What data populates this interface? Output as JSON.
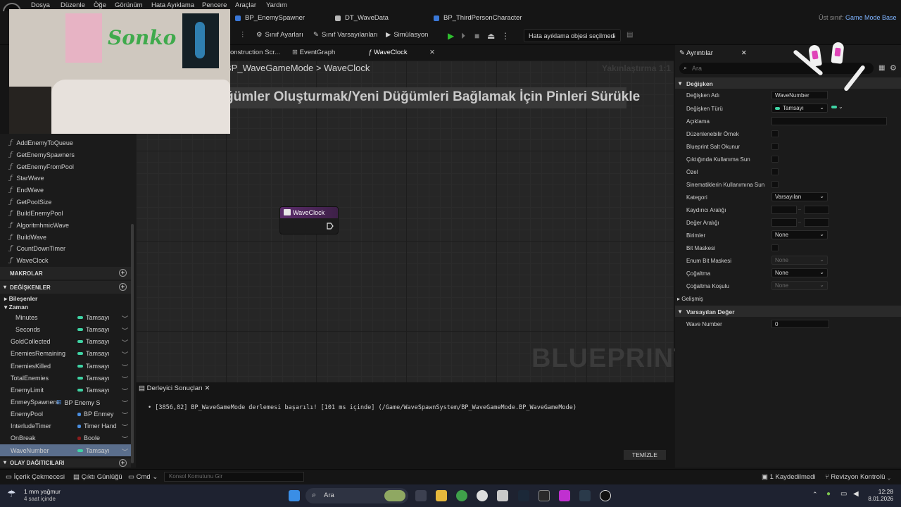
{
  "menu": [
    "Dosya",
    "Düzenle",
    "Öğe",
    "Görünüm",
    "Hata Ayıklama",
    "Pencere",
    "Araçlar",
    "Yardım"
  ],
  "tabs": {
    "items": [
      "BP_EnemySpawner",
      "DT_WaveData",
      "BP_ThirdPersonCharacter"
    ],
    "parent_label": "Üst sınıf:",
    "parent_value": "Game Mode Base"
  },
  "toolbar": {
    "class_settings": "Sınıf Ayarları",
    "class_defaults": "Sınıf Varsayılanları",
    "simulation": "Simülasyon",
    "debug_select": "Hata ayıklama objesi seçilmedi"
  },
  "graph_tabs": [
    "onstruction Scr...",
    "EventGraph",
    "WaveClock"
  ],
  "breadcrumb": {
    "root": "BP_WaveGameMode",
    "sep": ">",
    "leaf": "WaveClock"
  },
  "zoom": "Yakınlaştırma 1:1",
  "hint": "ğümler Oluşturmak/Yeni Düğümleri Bağlamak İçin Pinleri Sürükle",
  "watermark": "BLUEPRINT",
  "node": {
    "title": "WaveClock"
  },
  "functions": [
    "AddEnemyToQueue",
    "GetEnemySpawners",
    "GetEnemyFromPool",
    "StarWave",
    "EndWave",
    "GetPoolSize",
    "BuildEnemyPool",
    "AlgoritmhmicWave",
    "BuildWave",
    "CountDownTimer",
    "WaveClock"
  ],
  "sections": {
    "macros": "MAKROLAR",
    "variables": "DEĞİŞKENLER",
    "dispatchers": "OLAY DAĞITICILARI"
  },
  "categories": {
    "components": "Bileşenler",
    "time": "Zaman"
  },
  "variables": [
    {
      "name": "Minutes",
      "type": "Tamsayı",
      "color": "#3fd3a4"
    },
    {
      "name": "Seconds",
      "type": "Tamsayı",
      "color": "#3fd3a4"
    },
    {
      "name": "GoldCollected",
      "type": "Tamsayı",
      "color": "#3fd3a4"
    },
    {
      "name": "EnemiesRemaining",
      "type": "Tamsayı",
      "color": "#3fd3a4"
    },
    {
      "name": "EnemiesKilled",
      "type": "Tamsayı",
      "color": "#3fd3a4"
    },
    {
      "name": "TotalEnemies",
      "type": "Tamsayı",
      "color": "#3fd3a4"
    },
    {
      "name": "EnemyLimit",
      "type": "Tamsayı",
      "color": "#3fd3a4"
    },
    {
      "name": "EnmeySpawners",
      "type": "BP Enemy S",
      "color": "#4a8ee0"
    },
    {
      "name": "EnemyPool",
      "type": "BP Enmey",
      "color": "#4a8ee0"
    },
    {
      "name": "InterludeTimer",
      "type": "Timer Hand",
      "color": "#4a8ee0"
    },
    {
      "name": "OnBreak",
      "type": "Boole",
      "color": "#8a1c1c"
    },
    {
      "name": "WaveNumber",
      "type": "Tamsayı",
      "color": "#3fd3a4"
    }
  ],
  "compiler": {
    "tab": "Derleyici Sonuçları",
    "message": "[3856,82] BP_WaveGameMode derlemesi başarılı! [101 ms içinde] (/Game/WaveSpawnSystem/BP_WaveGameMode.BP_WaveGameMode)",
    "clear": "TEMİZLE"
  },
  "details": {
    "tab": "Ayrıntılar",
    "search_placeholder": "Ara",
    "section_variable": "Değişken",
    "labels": {
      "var_name": "Değişken Adı",
      "var_type": "Değişken Türü",
      "description": "Açıklama",
      "instance_editable": "Düzenlenebilir Örnek",
      "bp_readonly": "Blueprint Salt Okunur",
      "expose_spawn": "Çıktığında Kullanıma Sun",
      "private": "Özel",
      "expose_cine": "Sinematiklerin Kullanımına Sun",
      "category": "Kategori",
      "slider_range": "Kaydırıcı Aralığı",
      "value_range": "Değer Aralığı",
      "units": "Birimler",
      "bitmask": "Bit Maskesi",
      "bitmask_enum": "Enum Bit Maskesi",
      "replication": "Çoğaltma",
      "rep_condition": "Çoğaltma Koşulu",
      "advanced": "Gelişmiş"
    },
    "values": {
      "var_name": "WaveNumber",
      "var_type": "Tamsayı",
      "category": "Varsayılan",
      "units": "None",
      "bitmask_enum": "None",
      "replication": "None",
      "rep_condition": "None",
      "range_sep": "..",
      "default_value": "0"
    },
    "section_default": "Varsayılan Değer",
    "default_label": "Wave Number"
  },
  "statusbar": {
    "content_drawer": "İçerik Çekmecesi",
    "output_log": "Çıktı Günlüğü",
    "cmd": "Cmd",
    "console_placeholder": "Konsol Komutunu Gir",
    "saved": "1 Kaydedilmedi",
    "revision": "Revizyon Kontrolü"
  },
  "taskbar": {
    "weather_temp": "1 mm yağmur",
    "weather_sub": "4 saat içinde",
    "search": "Ara",
    "time": "12:28",
    "date": "8.01.2026"
  },
  "webcam": {
    "graffiti": "Sonko"
  }
}
